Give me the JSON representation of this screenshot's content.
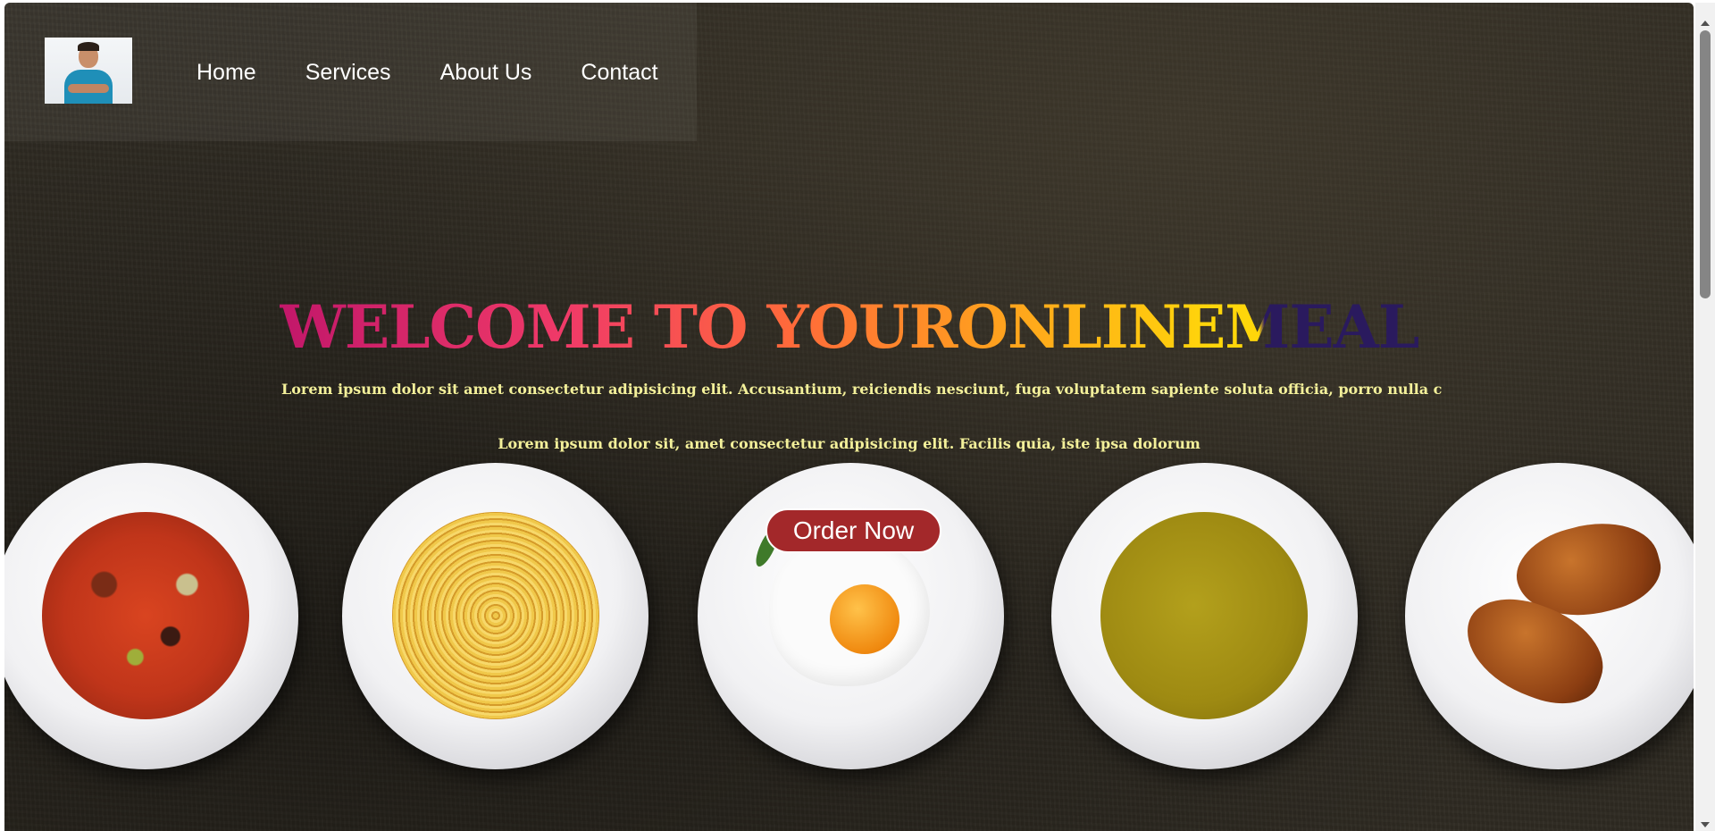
{
  "nav": {
    "logo_icon": "profile-photo",
    "links": [
      "Home",
      "Services",
      "About Us",
      "Contact"
    ]
  },
  "hero": {
    "title": "WELCOME TO YOURONLINEMEAL",
    "paragraph_1": "Lorem ipsum dolor sit amet consectetur adipisicing elit. Accusantium, reiciendis nesciunt, fuga voluptatem sapiente soluta officia, porro nulla c",
    "paragraph_2": "Lorem ipsum dolor sit, amet consectetur adipisicing elit. Facilis quia, iste ipsa dolorum",
    "order_button": "Order Now",
    "title_gradient": [
      "#c2176a",
      "#f03a68",
      "#ff6a3a",
      "#ff9e1f",
      "#ffd60a",
      "#2a1a5e"
    ],
    "text_color": "#f3f09a",
    "button_color": "#a3282a"
  },
  "plates": [
    "minestrone-soup",
    "spaghetti",
    "fried-egg",
    "pea-soup",
    "croissants"
  ]
}
